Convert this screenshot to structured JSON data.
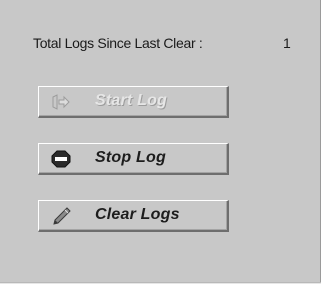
{
  "stats": {
    "label": "Total Logs Since Last Clear :",
    "count": "1"
  },
  "buttons": {
    "start": {
      "label": "Start Log",
      "icon": "start-log-icon",
      "enabled": false
    },
    "stop": {
      "label": "Stop Log",
      "icon": "stop-sign-icon",
      "enabled": true
    },
    "clear": {
      "label": "Clear Logs",
      "icon": "eraser-icon",
      "enabled": true
    }
  },
  "colors": {
    "panel_bg": "#c8c8c8",
    "disabled_text": "#e6e6e6",
    "text": "#1d1d1d"
  }
}
